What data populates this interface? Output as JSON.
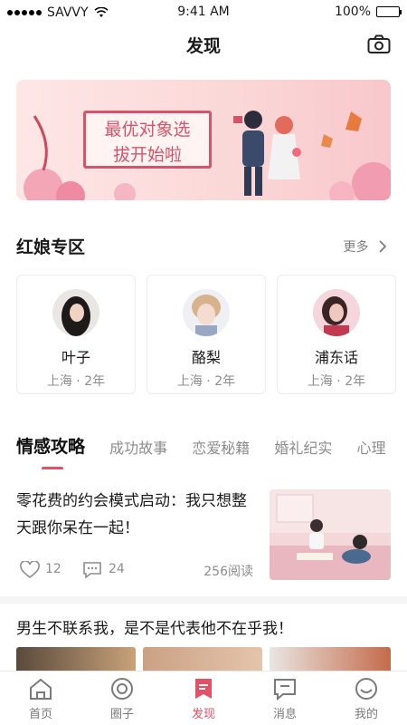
{
  "status": {
    "carrier": "SAVVY",
    "time": "9:41 AM",
    "battery": "100%",
    "battery_level": 1.0
  },
  "nav": {
    "title": "发现",
    "right_icon": "camera-icon"
  },
  "banner": {
    "line1": "最优对象选",
    "line2": "拔开始啦"
  },
  "matchmaker": {
    "title": "红娘专区",
    "more": "更多",
    "cards": [
      {
        "name": "叶子",
        "meta": "上海 · 2年"
      },
      {
        "name": "酪梨",
        "meta": "上海 · 2年"
      },
      {
        "name": "浦东话",
        "meta": "上海 · 2年"
      }
    ]
  },
  "tabs": [
    "情感攻略",
    "成功故事",
    "恋爱秘籍",
    "婚礼纪实",
    "心理"
  ],
  "article1": {
    "title": "零花费的约会模式启动：我只想整天跟你呆在一起！",
    "likes": "12",
    "comments": "24",
    "reads": "256阅读"
  },
  "article2": {
    "title": "男生不联系我，是不是代表他不在乎我！"
  },
  "tabbar": [
    {
      "label": "首页",
      "icon": "home-icon"
    },
    {
      "label": "圈子",
      "icon": "circle-icon"
    },
    {
      "label": "发现",
      "icon": "bookmark-icon"
    },
    {
      "label": "消息",
      "icon": "message-icon"
    },
    {
      "label": "我的",
      "icon": "smile-icon"
    }
  ],
  "colors": {
    "accent": "#e65064"
  }
}
